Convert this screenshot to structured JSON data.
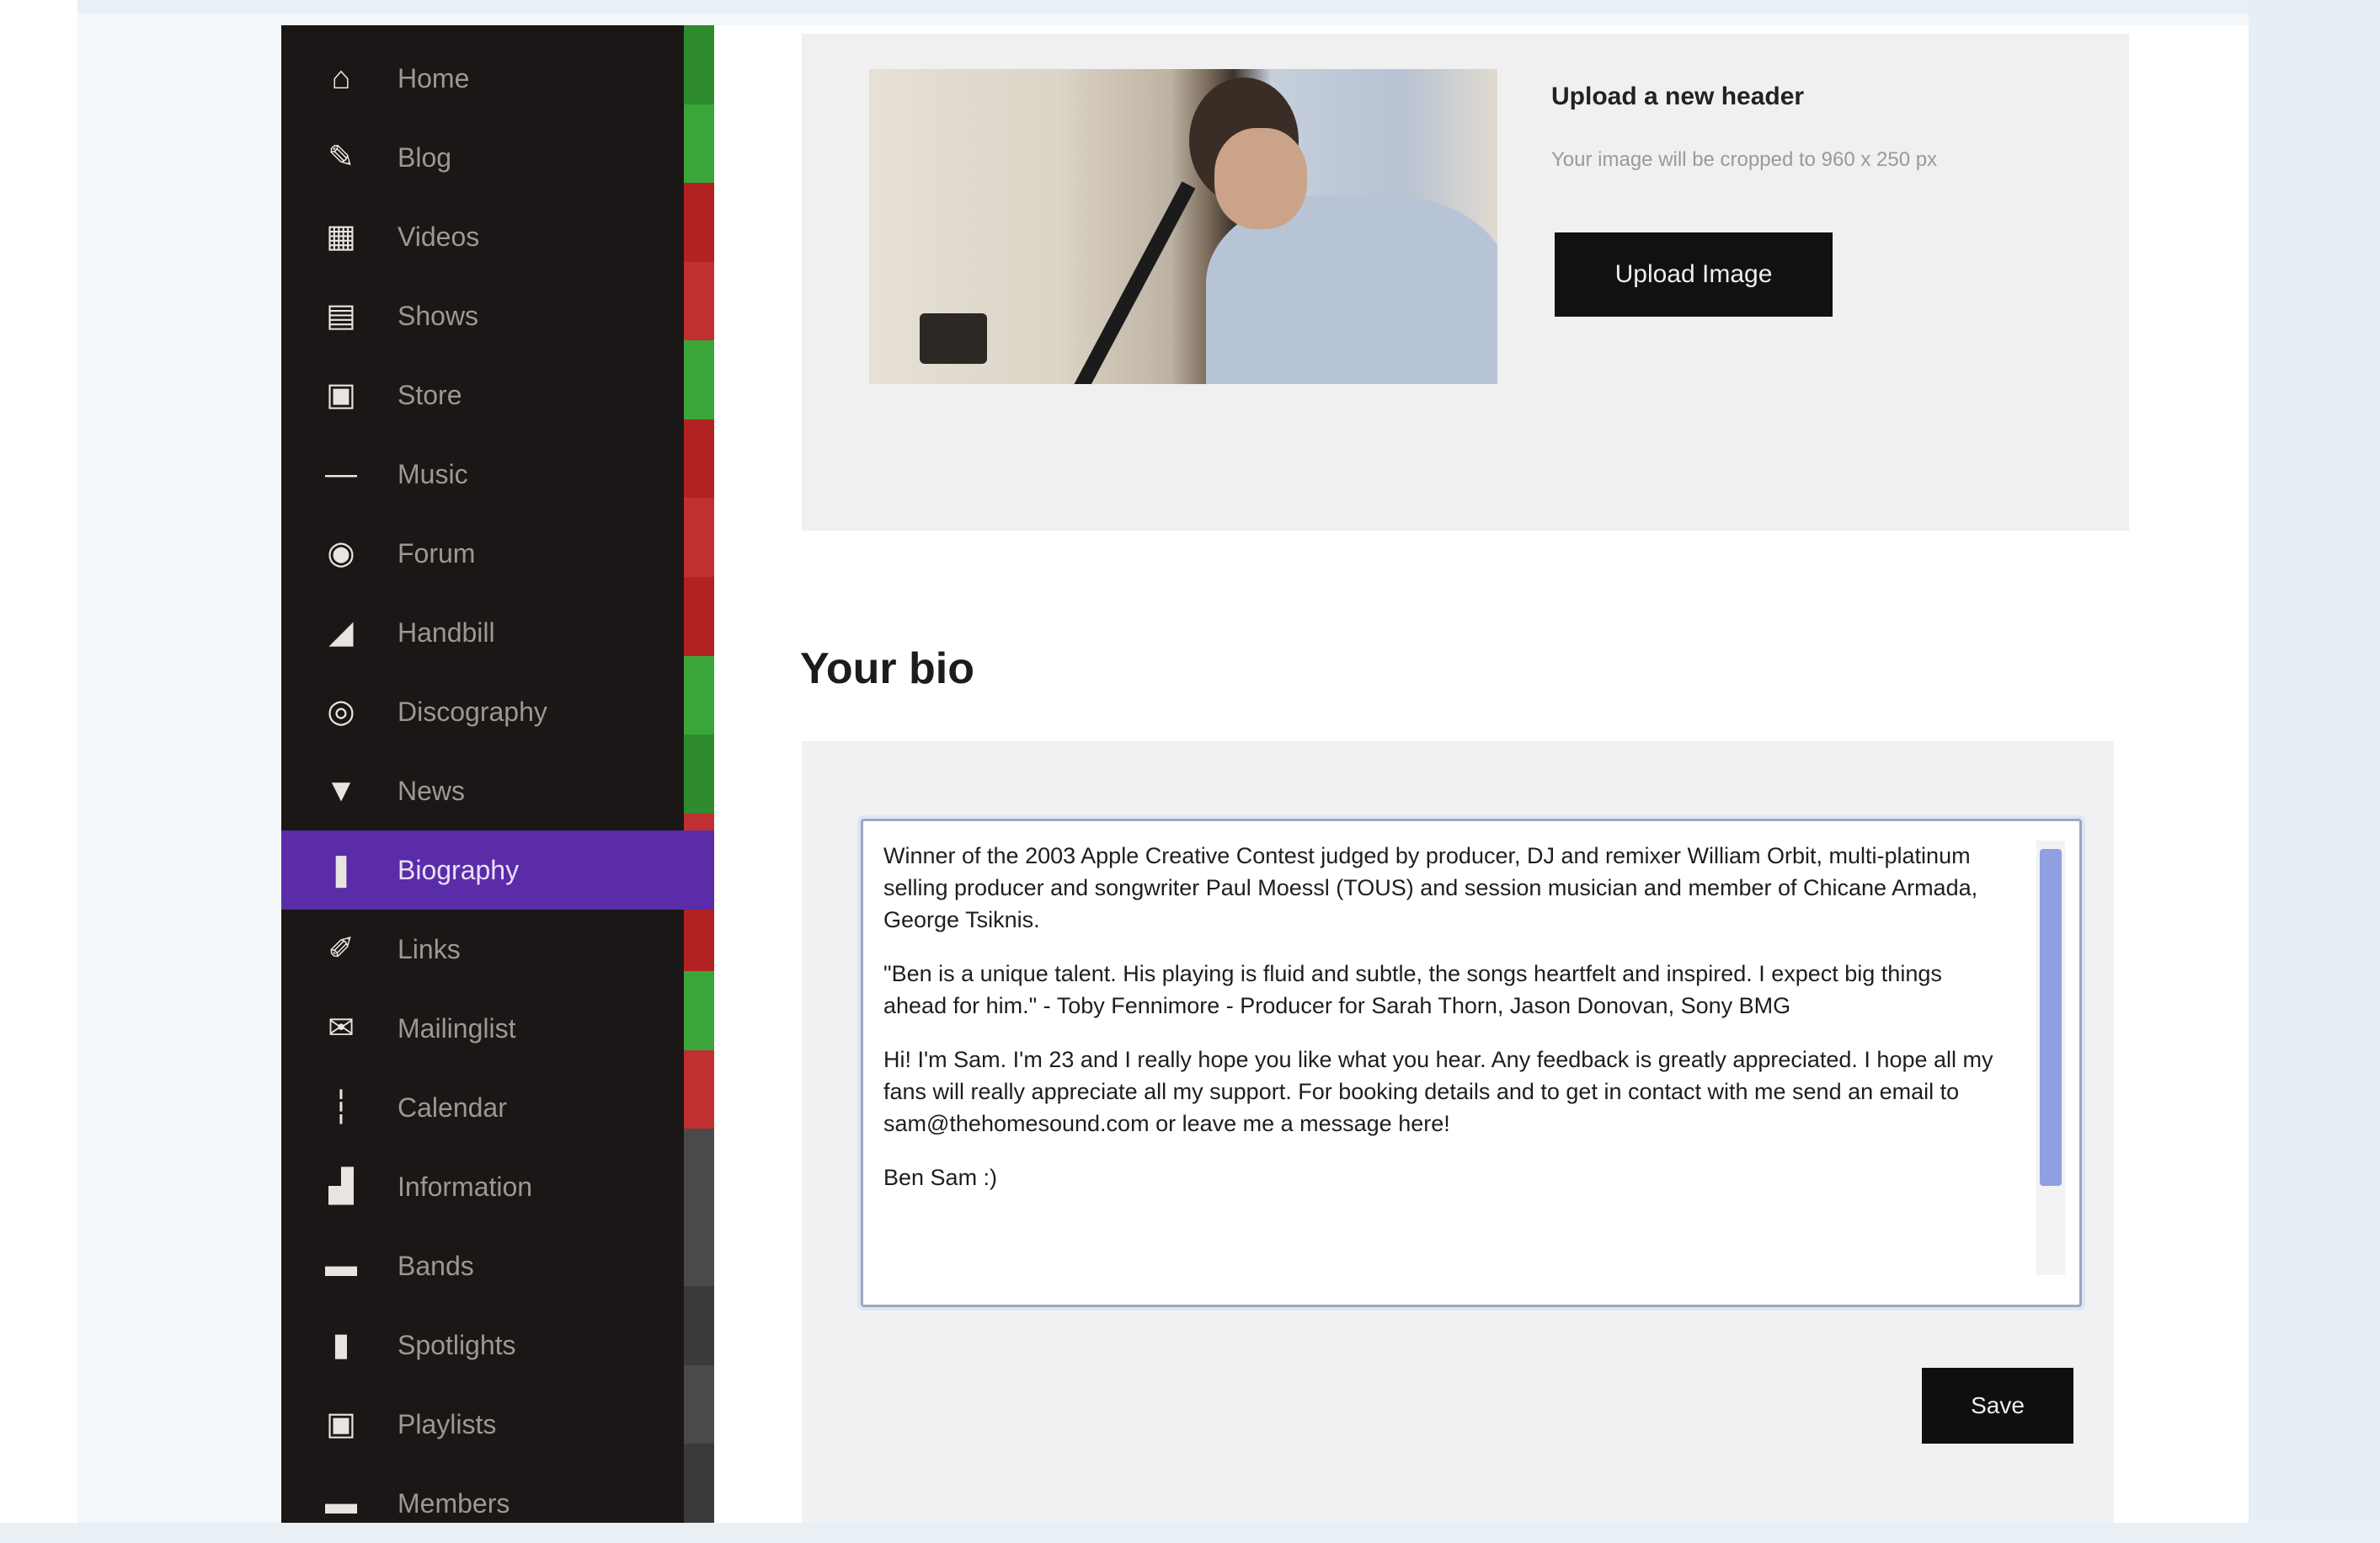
{
  "sidebar": {
    "items": [
      {
        "label": "Home",
        "icon": "home-icon",
        "glyph": "⌂"
      },
      {
        "label": "Blog",
        "icon": "pen-icon",
        "glyph": "✎"
      },
      {
        "label": "Videos",
        "icon": "film-icon",
        "glyph": "▦"
      },
      {
        "label": "Shows",
        "icon": "ticket-icon",
        "glyph": "▤"
      },
      {
        "label": "Store",
        "icon": "store-icon",
        "glyph": "▣"
      },
      {
        "label": "Music",
        "icon": "music-icon",
        "glyph": "—"
      },
      {
        "label": "Forum",
        "icon": "chat-icon",
        "glyph": "◉"
      },
      {
        "label": "Handbill",
        "icon": "megaphone-icon",
        "glyph": "◢"
      },
      {
        "label": "Discography",
        "icon": "disc-icon",
        "glyph": "◎"
      },
      {
        "label": "News",
        "icon": "trophy-icon",
        "glyph": "▼"
      },
      {
        "label": "Biography",
        "icon": "microphone-icon",
        "glyph": "❚"
      },
      {
        "label": "Links",
        "icon": "link-icon",
        "glyph": "✐"
      },
      {
        "label": "Mailinglist",
        "icon": "mail-icon",
        "glyph": "✉"
      },
      {
        "label": "Calendar",
        "icon": "calendar-icon",
        "glyph": "┆"
      },
      {
        "label": "Information",
        "icon": "info-icon",
        "glyph": "▟"
      },
      {
        "label": "Bands",
        "icon": "band-icon",
        "glyph": "▬"
      },
      {
        "label": "Spotlights",
        "icon": "spotlight-icon",
        "glyph": "▮"
      },
      {
        "label": "Playlists",
        "icon": "playlist-icon",
        "glyph": "▣"
      },
      {
        "label": "Members",
        "icon": "members-icon",
        "glyph": "▬"
      }
    ],
    "active_index": 10,
    "strip_colors": [
      "#2e8b2e",
      "#3aa63a",
      "#b22222",
      "#c03030",
      "#3aa63a",
      "#b22222",
      "#c03030",
      "#b22222",
      "#3aa63a",
      "#2e8b2e",
      "#c03030",
      "#b22222",
      "#3aa63a",
      "#c03030",
      "#4a4a4a",
      "#4a4a4a",
      "#3a3a3a",
      "#4a4a4a",
      "#3a3a3a"
    ]
  },
  "header": {
    "upload_title": "Upload a new header",
    "upload_desc": "Your image will be cropped to 960 x 250 px",
    "upload_button": "Upload Image"
  },
  "bio": {
    "heading": "Your bio",
    "paragraphs": [
      "Winner of the 2003 Apple Creative Contest judged by producer, DJ and remixer William Orbit, multi-platinum selling producer and songwriter Paul Moessl (TOUS) and session musician and member of Chicane Armada, George Tsiknis.",
      "\"Ben is a unique talent. His playing is fluid and subtle, the songs heartfelt and inspired. I expect big things ahead for him.\" - Toby Fennimore - Producer for Sarah Thorn, Jason Donovan, Sony BMG",
      "Hi! I'm Sam. I'm 23 and I really hope you like what you hear. Any feedback is greatly appreciated. I hope all my fans will really appreciate all my support. For booking details and to get in contact with me send an email to sam@thehomesound.com or leave me a message here!",
      "Ben Sam :)"
    ],
    "save_button": "Save"
  },
  "colors": {
    "sidebar_bg": "#1a1716",
    "active_item": "#5a2ca8",
    "button_bg": "#111111",
    "scroll_thumb": "#8f9fdf"
  }
}
